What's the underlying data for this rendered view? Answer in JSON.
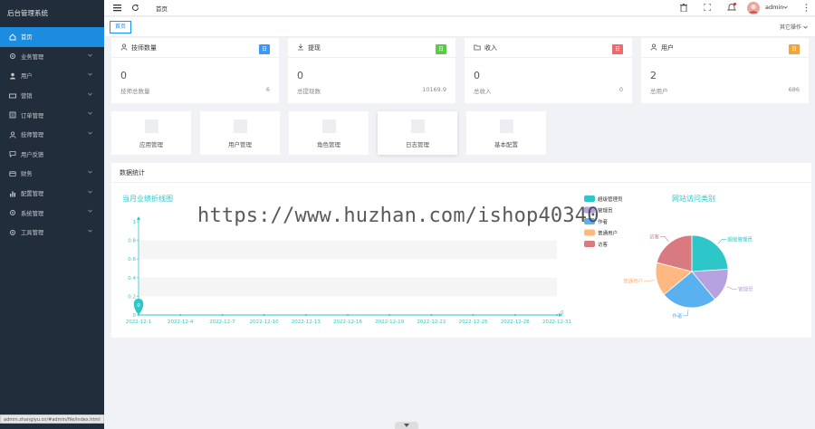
{
  "app_title": "后台管理系统",
  "sidebar": {
    "items": [
      {
        "label": "首页",
        "icon": "home-icon",
        "active": true,
        "has_children": false
      },
      {
        "label": "业务管理",
        "icon": "gear-icon",
        "active": false,
        "has_children": true
      },
      {
        "label": "用户",
        "icon": "user-icon",
        "active": false,
        "has_children": true
      },
      {
        "label": "营销",
        "icon": "ticket-icon",
        "active": false,
        "has_children": true
      },
      {
        "label": "订单管理",
        "icon": "order-icon",
        "active": false,
        "has_children": true
      },
      {
        "label": "技师管理",
        "icon": "worker-icon",
        "active": false,
        "has_children": true
      },
      {
        "label": "用户反馈",
        "icon": "chat-icon",
        "active": false,
        "has_children": false
      },
      {
        "label": "财务",
        "icon": "wallet-icon",
        "active": false,
        "has_children": true
      },
      {
        "label": "配置管理",
        "icon": "bar-chart-icon",
        "active": false,
        "has_children": true
      },
      {
        "label": "系统管理",
        "icon": "gear-icon",
        "active": false,
        "has_children": true
      },
      {
        "label": "工具管理",
        "icon": "gear-icon",
        "active": false,
        "has_children": true
      }
    ]
  },
  "topbar": {
    "breadcrumb": "首页",
    "username": "admin"
  },
  "tabs": {
    "active": "首页",
    "other_ops": "其它操作"
  },
  "cards": [
    {
      "title": "技师数量",
      "badge": "日",
      "badge_color": "#3c97f5",
      "value": "0",
      "foot_label": "技师总数量",
      "foot_value": "6"
    },
    {
      "title": "提现",
      "badge": "日",
      "badge_color": "#5cc94d",
      "value": "0",
      "foot_label": "总提现数",
      "foot_value": "10169.9"
    },
    {
      "title": "收入",
      "badge": "日",
      "badge_color": "#ef6a6a",
      "value": "0",
      "foot_label": "总收入",
      "foot_value": "0"
    },
    {
      "title": "用户",
      "badge": "日",
      "badge_color": "#f0a53a",
      "value": "2",
      "foot_label": "总用户",
      "foot_value": "686"
    }
  ],
  "shortcuts": [
    "应用管理",
    "用户管理",
    "角色管理",
    "日志管理",
    "基本配置"
  ],
  "stats": {
    "title": "数据统计"
  },
  "chart_data": [
    {
      "type": "line",
      "title": "当月业绩折线图",
      "x": [
        "2022-12-1",
        "2022-12-4",
        "2022-12-7",
        "2022-12-10",
        "2022-12-13",
        "2022-12-16",
        "2022-12-19",
        "2022-12-22",
        "2022-12-25",
        "2022-12-28",
        "2022-12-31"
      ],
      "y_ticks": [
        "1",
        "0.8",
        "0.6",
        "0.4",
        "0.2",
        "0"
      ],
      "ylim": [
        0,
        1
      ],
      "series": [
        {
          "values": [
            0,
            0,
            0,
            0,
            0,
            0,
            0,
            0,
            0,
            0,
            0
          ]
        }
      ],
      "point_labels": {
        "first": "0",
        "last": "0"
      },
      "color": "#2ec7c9"
    },
    {
      "type": "pie",
      "title": "网站访问类别",
      "slices": [
        {
          "name": "超级管理员",
          "value": 24,
          "color": "#2ec7c9"
        },
        {
          "name": "管理员",
          "value": 15,
          "color": "#b6a2de"
        },
        {
          "name": "作者",
          "value": 25,
          "color": "#5ab1ef"
        },
        {
          "name": "普通用户",
          "value": 15,
          "color": "#ffb980"
        },
        {
          "name": "访客",
          "value": 21,
          "color": "#d87a80"
        }
      ],
      "legend": [
        "超级管理员",
        "管理员",
        "作者",
        "普通用户",
        "访客"
      ],
      "legend_position": "top-left"
    }
  ],
  "footer": {
    "status_url": "admin.zhangiyu.cn/#admin/file/index.html"
  },
  "watermark": "https://www.huzhan.com/ishop40340"
}
